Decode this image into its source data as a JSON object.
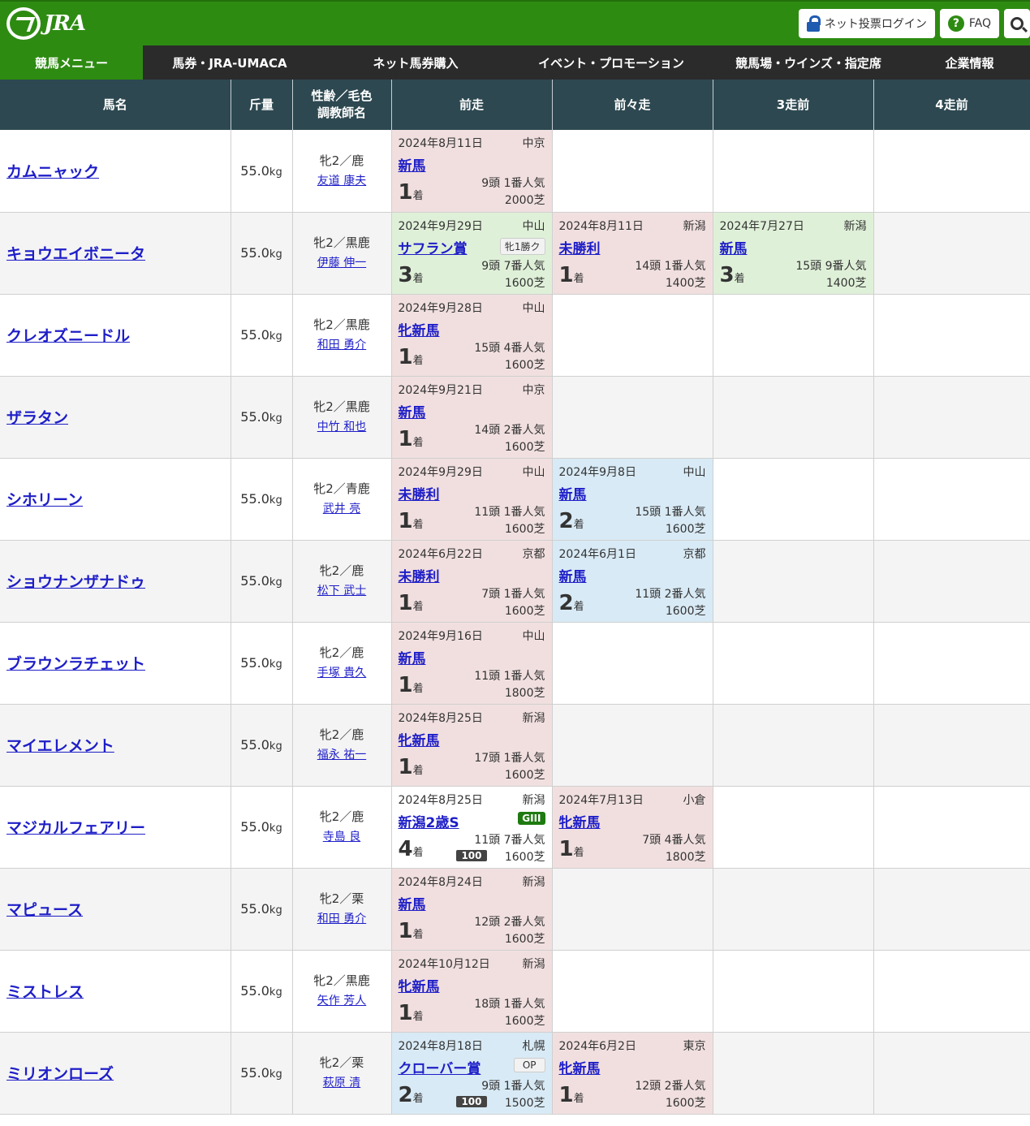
{
  "header": {
    "logo_text": "JRA",
    "login_label": "ネット投票ログイン",
    "faq_label": "FAQ"
  },
  "nav": [
    "競馬メニュー",
    "馬券・JRA-UMACA",
    "ネット馬券購入",
    "イベント・プロモーション",
    "競馬場・ウインズ・指定席",
    "企業情報"
  ],
  "table": {
    "headers": {
      "name": "馬名",
      "weight": "斤量",
      "sex_line1": "性齢／毛色",
      "sex_line2": "調教師名",
      "r1": "前走",
      "r2": "前々走",
      "r3": "3走前",
      "r4": "4走前"
    },
    "rows": [
      {
        "name": "カムニャック",
        "weight": "55.0",
        "unit": "kg",
        "sex": "牝2／鹿",
        "trainer": "友道 康夫",
        "races": [
          {
            "color": "pink",
            "date": "2024年8月11日",
            "place": "中京",
            "race": "新馬",
            "field": "9頭 1番人気",
            "dist": "2000芝",
            "pos": "1",
            "suffix": "着"
          }
        ]
      },
      {
        "name": "キョウエイボニータ",
        "weight": "55.0",
        "unit": "kg",
        "sex": "牝2／黒鹿",
        "trainer": "伊藤 伸一",
        "races": [
          {
            "color": "green",
            "date": "2024年9月29日",
            "place": "中山",
            "race": "サフラン賞",
            "grade": "牝1勝ク",
            "grade_type": "cls",
            "field": "9頭 7番人気",
            "dist": "1600芝",
            "pos": "3",
            "suffix": "着"
          },
          {
            "color": "pink",
            "date": "2024年8月11日",
            "place": "新潟",
            "race": "未勝利",
            "field": "14頭 1番人気",
            "dist": "1400芝",
            "pos": "1",
            "suffix": "着"
          },
          {
            "color": "green",
            "date": "2024年7月27日",
            "place": "新潟",
            "race": "新馬",
            "field": "15頭 9番人気",
            "dist": "1400芝",
            "pos": "3",
            "suffix": "着"
          }
        ]
      },
      {
        "name": "クレオズニードル",
        "weight": "55.0",
        "unit": "kg",
        "sex": "牝2／黒鹿",
        "trainer": "和田 勇介",
        "races": [
          {
            "color": "pink",
            "date": "2024年9月28日",
            "place": "中山",
            "race": "牝新馬",
            "field": "15頭 4番人気",
            "dist": "1600芝",
            "pos": "1",
            "suffix": "着"
          }
        ]
      },
      {
        "name": "ザラタン",
        "weight": "55.0",
        "unit": "kg",
        "sex": "牝2／黒鹿",
        "trainer": "中竹 和也",
        "races": [
          {
            "color": "pink",
            "date": "2024年9月21日",
            "place": "中京",
            "race": "新馬",
            "field": "14頭 2番人気",
            "dist": "1600芝",
            "pos": "1",
            "suffix": "着"
          }
        ]
      },
      {
        "name": "シホリーン",
        "weight": "55.0",
        "unit": "kg",
        "sex": "牝2／青鹿",
        "trainer": "武井 亮",
        "races": [
          {
            "color": "pink",
            "date": "2024年9月29日",
            "place": "中山",
            "race": "未勝利",
            "field": "11頭 1番人気",
            "dist": "1600芝",
            "pos": "1",
            "suffix": "着"
          },
          {
            "color": "blue",
            "date": "2024年9月8日",
            "place": "中山",
            "race": "新馬",
            "field": "15頭 1番人気",
            "dist": "1600芝",
            "pos": "2",
            "suffix": "着"
          }
        ]
      },
      {
        "name": "ショウナンザナドゥ",
        "weight": "55.0",
        "unit": "kg",
        "sex": "牝2／鹿",
        "trainer": "松下 武士",
        "races": [
          {
            "color": "pink",
            "date": "2024年6月22日",
            "place": "京都",
            "race": "未勝利",
            "field": "7頭 1番人気",
            "dist": "1600芝",
            "pos": "1",
            "suffix": "着"
          },
          {
            "color": "blue",
            "date": "2024年6月1日",
            "place": "京都",
            "race": "新馬",
            "field": "11頭 2番人気",
            "dist": "1600芝",
            "pos": "2",
            "suffix": "着"
          }
        ]
      },
      {
        "name": "ブラウンラチェット",
        "weight": "55.0",
        "unit": "kg",
        "sex": "牝2／鹿",
        "trainer": "手塚 貴久",
        "races": [
          {
            "color": "pink",
            "date": "2024年9月16日",
            "place": "中山",
            "race": "新馬",
            "field": "11頭 1番人気",
            "dist": "1800芝",
            "pos": "1",
            "suffix": "着"
          }
        ]
      },
      {
        "name": "マイエレメント",
        "weight": "55.0",
        "unit": "kg",
        "sex": "牝2／鹿",
        "trainer": "福永 祐一",
        "races": [
          {
            "color": "pink",
            "date": "2024年8月25日",
            "place": "新潟",
            "race": "牝新馬",
            "field": "17頭 1番人気",
            "dist": "1600芝",
            "pos": "1",
            "suffix": "着"
          }
        ]
      },
      {
        "name": "マジカルフェアリー",
        "weight": "55.0",
        "unit": "kg",
        "sex": "牝2／鹿",
        "trainer": "寺島 良",
        "races": [
          {
            "color": "white",
            "date": "2024年8月25日",
            "place": "新潟",
            "race": "新潟2歳S",
            "grade": "GIII",
            "grade_type": "g3",
            "field": "11頭 7番人気",
            "dist": "1600芝",
            "pos": "4",
            "suffix": "着",
            "rating": "100"
          },
          {
            "color": "pink",
            "date": "2024年7月13日",
            "place": "小倉",
            "race": "牝新馬",
            "field": "7頭 4番人気",
            "dist": "1800芝",
            "pos": "1",
            "suffix": "着"
          }
        ]
      },
      {
        "name": "マピュース",
        "weight": "55.0",
        "unit": "kg",
        "sex": "牝2／栗",
        "trainer": "和田 勇介",
        "races": [
          {
            "color": "pink",
            "date": "2024年8月24日",
            "place": "新潟",
            "race": "新馬",
            "field": "12頭 2番人気",
            "dist": "1600芝",
            "pos": "1",
            "suffix": "着"
          }
        ]
      },
      {
        "name": "ミストレス",
        "weight": "55.0",
        "unit": "kg",
        "sex": "牝2／黒鹿",
        "trainer": "矢作 芳人",
        "races": [
          {
            "color": "pink",
            "date": "2024年10月12日",
            "place": "新潟",
            "race": "牝新馬",
            "field": "18頭 1番人気",
            "dist": "1600芝",
            "pos": "1",
            "suffix": "着"
          }
        ]
      },
      {
        "name": "ミリオンローズ",
        "weight": "55.0",
        "unit": "kg",
        "sex": "牝2／栗",
        "trainer": "萩原 清",
        "races": [
          {
            "color": "blue",
            "date": "2024年8月18日",
            "place": "札幌",
            "race": "クローバー賞",
            "grade": "OP",
            "grade_type": "op",
            "field": "9頭 1番人気",
            "dist": "1500芝",
            "pos": "2",
            "suffix": "着",
            "rating": "100"
          },
          {
            "color": "pink",
            "date": "2024年6月2日",
            "place": "東京",
            "race": "牝新馬",
            "field": "12頭 2番人気",
            "dist": "1600芝",
            "pos": "1",
            "suffix": "着"
          }
        ]
      }
    ]
  }
}
